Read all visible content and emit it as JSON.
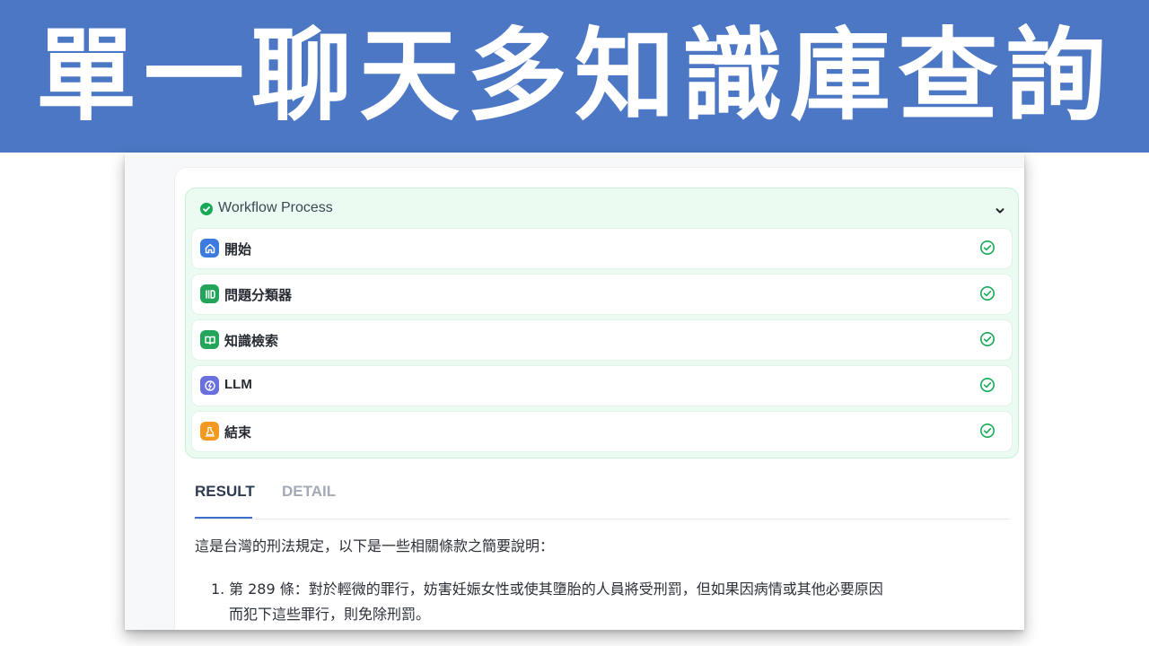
{
  "banner": {
    "title": "單一聊天多知識庫查詢"
  },
  "workflow": {
    "title": "Workflow Process",
    "status_color": "#18a957",
    "steps": [
      {
        "label": "開始",
        "icon": "home-icon",
        "color": "#3b7be0"
      },
      {
        "label": "問題分類器",
        "icon": "classifier-icon",
        "color": "#22a45a"
      },
      {
        "label": "知識檢索",
        "icon": "book-icon",
        "color": "#22a45a"
      },
      {
        "label": "LLM",
        "icon": "llm-icon",
        "color": "#6a6fe0"
      },
      {
        "label": "結束",
        "icon": "end-icon",
        "color": "#f39a1e"
      }
    ]
  },
  "tabs": {
    "result": "RESULT",
    "detail": "DETAIL"
  },
  "result": {
    "intro": "這是台灣的刑法規定，以下是一些相關條款之簡要說明：",
    "items": [
      {
        "number": "1.",
        "line1": "第 289 條：對於輕微的罪行，妨害妊娠女性或使其墮胎的人員將受刑罰，但如果因病情或其他必要原因",
        "line2": "而犯下這些罪行，則免除刑罰。"
      }
    ]
  }
}
